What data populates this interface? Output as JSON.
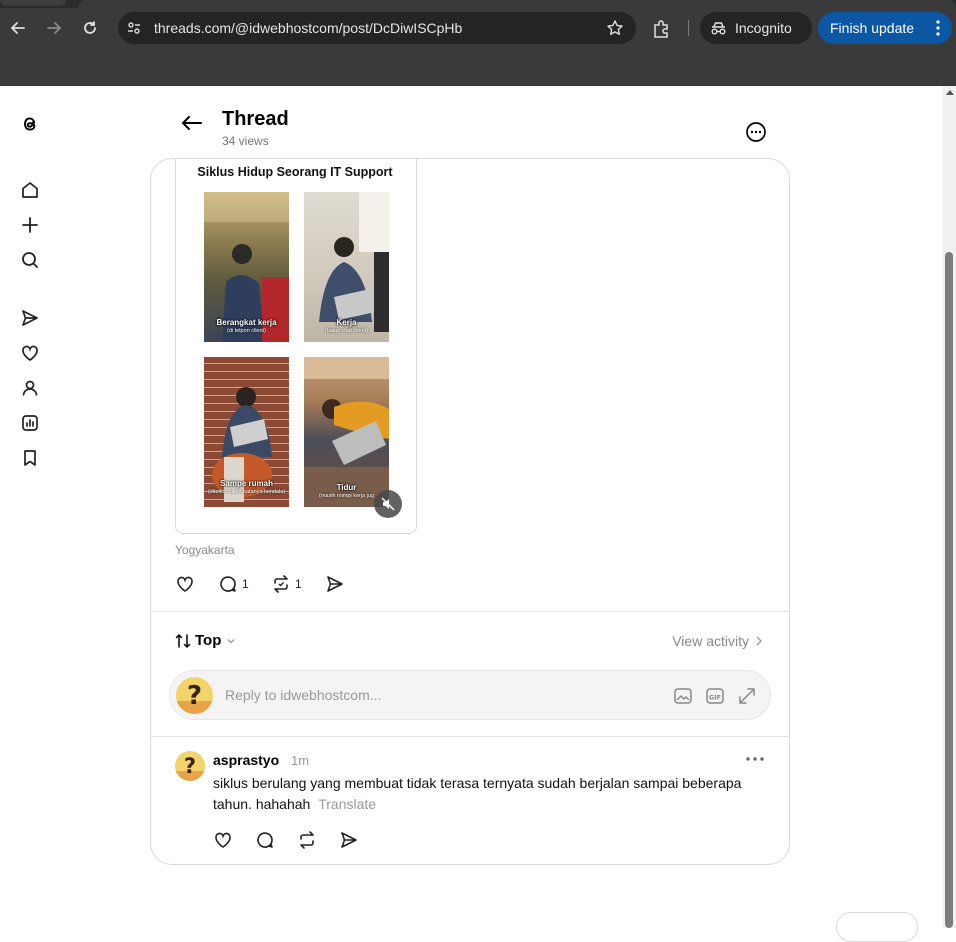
{
  "browser": {
    "url": "threads.com/@idwebhostcom/post/DcDiwISCpHb",
    "incognito_label": "Incognito",
    "update_label": "Finish update"
  },
  "header": {
    "title": "Thread",
    "views": "34 views"
  },
  "post": {
    "media_title": "Siklus Hidup Seorang IT Support",
    "tiles": [
      {
        "caption": "Berangkat kerja",
        "sub": "(di telpon client)"
      },
      {
        "caption": "Kerja",
        "sub": "(balas chat client)"
      },
      {
        "caption": "Sampe rumah",
        "sub": "(ditelfon client katanya kendala)"
      },
      {
        "caption": "Tidur",
        "sub": "(masih mimpi kerja jug"
      }
    ],
    "location": "Yogyakarta",
    "reply_count": "1",
    "repost_count": "1"
  },
  "sort": {
    "label": "Top",
    "view_activity": "View activity"
  },
  "reply_box": {
    "placeholder": "Reply to idwebhostcom..."
  },
  "comment": {
    "username": "asprastyo",
    "time": "1m",
    "text": "siklus berulang yang membuat tidak terasa ternyata sudah berjalan sampai beberapa tahun. hahahah",
    "translate": "Translate"
  },
  "colors": {
    "chrome": "#3a3a3a",
    "omnibox": "#242424",
    "update_button": "#0b57a4",
    "border": "#d9d9d9",
    "muted_text": "#999999"
  }
}
